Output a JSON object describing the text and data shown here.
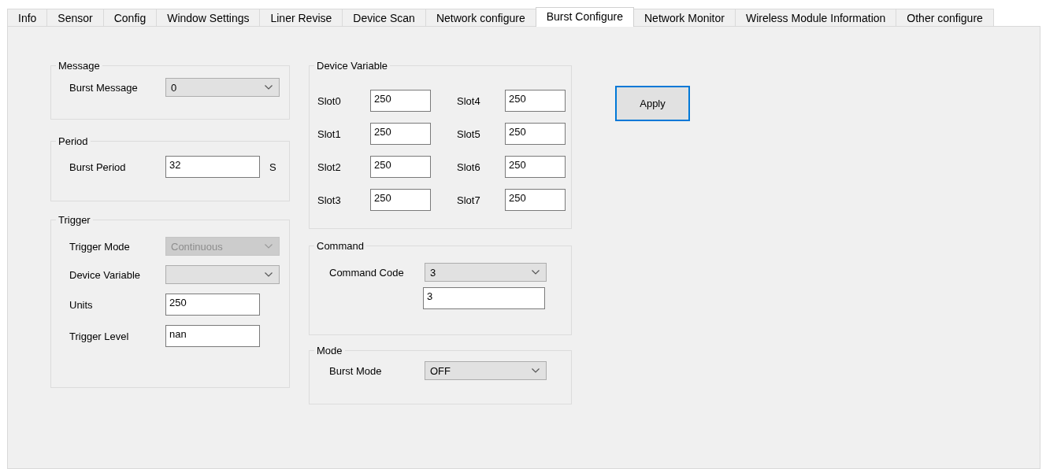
{
  "tabs": [
    {
      "label": "Info",
      "selected": false
    },
    {
      "label": "Sensor",
      "selected": false
    },
    {
      "label": "Config",
      "selected": false
    },
    {
      "label": "Window Settings",
      "selected": false
    },
    {
      "label": "Liner Revise",
      "selected": false
    },
    {
      "label": "Device Scan",
      "selected": false
    },
    {
      "label": "Network configure",
      "selected": false
    },
    {
      "label": "Burst Configure",
      "selected": true
    },
    {
      "label": "Network Monitor",
      "selected": false
    },
    {
      "label": "Wireless Module Information",
      "selected": false
    },
    {
      "label": "Other configure",
      "selected": false
    }
  ],
  "message": {
    "title": "Message",
    "burst_message": {
      "label": "Burst Message",
      "value": "0",
      "disabled": false
    }
  },
  "period": {
    "title": "Period",
    "burst_period": {
      "label": "Burst Period",
      "value": "32",
      "unit": "S"
    }
  },
  "trigger": {
    "title": "Trigger",
    "rows": [
      {
        "kind": "dropdown",
        "label": "Trigger Mode",
        "value": "Continuous",
        "disabled": true
      },
      {
        "kind": "dropdown",
        "label": "Device Variable",
        "disabled": false
      },
      {
        "kind": "input",
        "label": "Units",
        "value": "250"
      },
      {
        "kind": "input",
        "label": "Trigger Level",
        "value": "nan"
      }
    ]
  },
  "device_variable": {
    "title": "Device Variable",
    "slots": [
      {
        "label": "Slot0",
        "value": "250"
      },
      {
        "label": "Slot1",
        "value": "250"
      },
      {
        "label": "Slot2",
        "value": "250"
      },
      {
        "label": "Slot3",
        "value": "250"
      },
      {
        "label": "Slot4",
        "value": "250"
      },
      {
        "label": "Slot5",
        "value": "250"
      },
      {
        "label": "Slot6",
        "value": "250"
      },
      {
        "label": "Slot7",
        "value": "250"
      }
    ]
  },
  "command": {
    "title": "Command",
    "command_code": {
      "label": "Command Code",
      "value": "3",
      "disabled": false
    },
    "code_value": "3"
  },
  "mode": {
    "title": "Mode",
    "burst_mode": {
      "label": "Burst Mode",
      "value": "OFF",
      "disabled": false
    }
  },
  "apply_button": {
    "label": "Apply",
    "focused": true
  }
}
